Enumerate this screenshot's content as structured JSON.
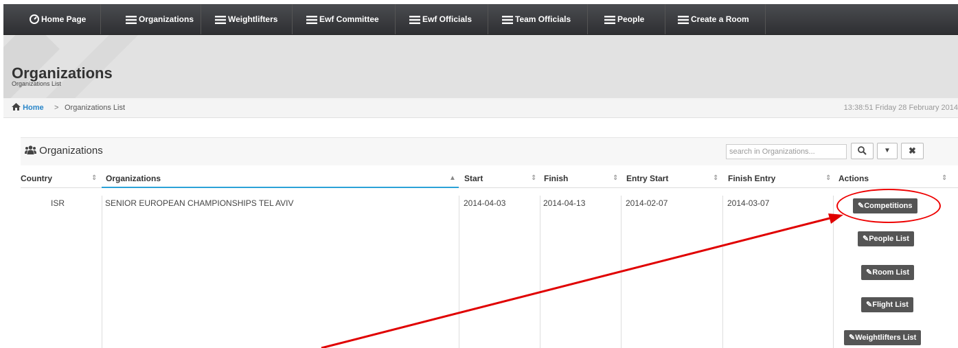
{
  "nav": {
    "items": [
      {
        "label": "Home Page",
        "icon": "dashboard-icon"
      },
      {
        "label": "Organizations",
        "icon": "list-icon"
      },
      {
        "label": "Weightlifters",
        "icon": "list-icon"
      },
      {
        "label": "Ewf Committee",
        "icon": "list-icon"
      },
      {
        "label": "Ewf Officials",
        "icon": "list-icon"
      },
      {
        "label": "Team Officials",
        "icon": "list-icon"
      },
      {
        "label": "People",
        "icon": "list-icon"
      },
      {
        "label": "Create a Room",
        "icon": "list-icon"
      }
    ]
  },
  "header": {
    "title": "Organizations",
    "subtitle": "Organizations List"
  },
  "breadcrumb": {
    "home": "Home",
    "separator": ">",
    "current": "Organizations List",
    "clock": "13:38:51 Friday 28 February 2014"
  },
  "panel": {
    "title": "Organizations",
    "search_placeholder": "search in Organizations...",
    "search_icon": "search-icon",
    "dropdown_icon": "caret-down-icon",
    "clear_icon": "close-icon"
  },
  "table": {
    "columns": [
      "Country",
      "Organizations",
      "Start",
      "Finish",
      "Entry Start",
      "Finish Entry",
      "Actions"
    ],
    "sort_asc_column": "Organizations",
    "rows": [
      {
        "country": "ISR",
        "organization": "SENIOR EUROPEAN CHAMPIONSHIPS TEL AVIV",
        "start": "2014-04-03",
        "finish": "2014-04-13",
        "entry_start": "2014-02-07",
        "finish_entry": "2014-03-07",
        "actions": [
          "Competitions",
          "People List",
          "Room List",
          "Flight List",
          "Weightlifters List"
        ]
      }
    ]
  },
  "annotation": {
    "color": "#e00000"
  }
}
